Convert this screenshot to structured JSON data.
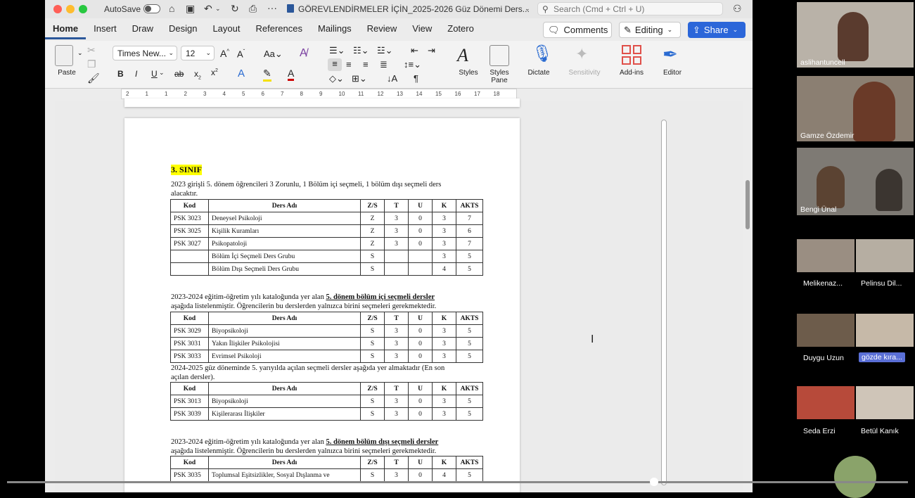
{
  "titlebar": {
    "autosave_label": "AutoSave",
    "doc_title": "GÖREVLENDİRMELER İÇİN_2025-2026 Güz Dönemi Ders...",
    "search_placeholder": "Search (Cmd + Ctrl + U)"
  },
  "tabs": [
    "Home",
    "Insert",
    "Draw",
    "Design",
    "Layout",
    "References",
    "Mailings",
    "Review",
    "View",
    "Zotero"
  ],
  "actions": {
    "comments": "Comments",
    "editing": "Editing",
    "share": "Share"
  },
  "ribbon": {
    "paste": "Paste",
    "font_name": "Times New...",
    "font_size": "12",
    "styles": "Styles",
    "styles_pane": "Styles Pane",
    "dictate": "Dictate",
    "sensitivity": "Sensitivity",
    "addins": "Add-ins",
    "editor": "Editor"
  },
  "ruler_marks": [
    "2",
    "1",
    "1",
    "2",
    "3",
    "4",
    "5",
    "6",
    "7",
    "8",
    "9",
    "10",
    "11",
    "12",
    "13",
    "14",
    "15",
    "16",
    "17",
    "18"
  ],
  "document": {
    "heading": "3. SINIF",
    "intro_line1": "2023 girişli 5. dönem öğrencileri 3 Zorunlu, 1 Bölüm içi seçmeli, 1 bölüm dışı seçmeli ders",
    "intro_line2": "alacaktır.",
    "headers": [
      "Kod",
      "Ders Adı",
      "Z/S",
      "T",
      "U",
      "K",
      "AKTS"
    ],
    "table1": [
      [
        "PSK 3023",
        "Deneysel Psikoloji",
        "Z",
        "3",
        "0",
        "3",
        "7"
      ],
      [
        "PSK 3025",
        "Kişilik Kuramları",
        "Z",
        "3",
        "0",
        "3",
        "6"
      ],
      [
        "PSK 3027",
        "Psikopatoloji",
        "Z",
        "3",
        "0",
        "3",
        "7"
      ],
      [
        "",
        "Bölüm İçi Seçmeli Ders Grubu",
        "S",
        "",
        "",
        "3",
        "5"
      ],
      [
        "",
        "Bölüm Dışı Seçmeli Ders Grubu",
        "S",
        "",
        "",
        "4",
        "5"
      ]
    ],
    "p2_pre": "2023-2024 eğitim-öğretim yılı kataloğunda yer alan ",
    "p2_bold": "5. dönem bölüm içi seçmeli dersler",
    "p2_line2": "aşağıda listelenmiştir. Öğrencilerin bu derslerden yalnızca birini seçmeleri gerekmektedir.",
    "table2": [
      [
        "PSK 3029",
        "Biyopsikoloji",
        "S",
        "3",
        "0",
        "3",
        "5"
      ],
      [
        "PSK 3031",
        "Yakın İlişkiler Psikolojisi",
        "S",
        "3",
        "0",
        "3",
        "5"
      ],
      [
        "PSK 3033",
        "Evrimsel Psikoloji",
        "S",
        "3",
        "0",
        "3",
        "5"
      ]
    ],
    "p3_line1": "2024-2025 güz döneminde 5. yarıyılda açılan seçmeli dersler aşağıda yer almaktadır (En son",
    "p3_line2": "açılan dersler).",
    "table3": [
      [
        "PSK 3013",
        "Biyopsikoloji",
        "S",
        "3",
        "0",
        "3",
        "5"
      ],
      [
        "PSK 3039",
        "Kişilerarası İlişkiler",
        "S",
        "3",
        "0",
        "3",
        "5"
      ]
    ],
    "p4_pre": "2023-2024 eğitim-öğretim yılı kataloğunda yer alan ",
    "p4_bold": "5. dönem bölüm dışı seçmeli dersler",
    "p4_line2": "aşağıda listelenmiştir. Öğrencilerin bu derslerden yalnızca birini seçmeleri gerekmektedir.",
    "table4": [
      [
        "PSK 3035",
        "Toplumsal Eşitsizlikler, Sosyal Dışlanma ve",
        "S",
        "3",
        "0",
        "4",
        "5"
      ]
    ]
  },
  "participants": {
    "p1": "aslihantuncell",
    "p2": "Gamze Özdemir",
    "p3": "Bengi Ünal",
    "p4": "Melikenaz...",
    "p5": "Pelinsu Dil...",
    "p6": "Duygu Uzun",
    "p7": "gözde kıra...",
    "p8": "Seda Erzi",
    "p9": "Betül Kanık"
  }
}
